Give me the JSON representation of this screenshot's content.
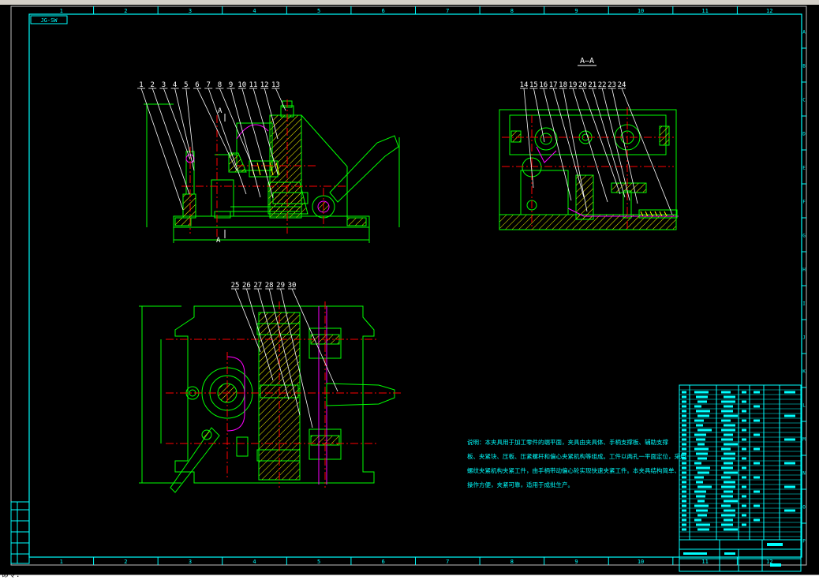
{
  "drawing": {
    "drawing_code_label": "JG-SW",
    "section_title": "A—A",
    "section_marker": "A",
    "grid_columns": [
      "1",
      "2",
      "3",
      "4",
      "5",
      "6",
      "7",
      "8",
      "9",
      "10",
      "11",
      "12"
    ],
    "grid_rows": [
      "A",
      "B",
      "C",
      "D",
      "E",
      "F",
      "G",
      "H",
      "I",
      "J",
      "K",
      "L",
      "M",
      "N",
      "O",
      "P"
    ],
    "front_view_callouts": [
      "1",
      "2",
      "3",
      "4",
      "5",
      "6",
      "7",
      "8",
      "9",
      "10",
      "11",
      "12",
      "13"
    ],
    "section_view_callouts": [
      "14",
      "15",
      "16",
      "17",
      "18",
      "19",
      "20",
      "21",
      "22",
      "23",
      "24"
    ],
    "top_view_callouts": [
      "25",
      "26",
      "27",
      "28",
      "29",
      "30"
    ],
    "tech_notes": [
      "说明：本夹具用于加工零件的端平面，夹具由夹具体、手柄支撑板、辅助支撑",
      "板、夹紧块、压板、压紧螺杆和偏心夹紧机构等组成。工件以两孔一平面定位，采用",
      "螺纹夹紧机构夹紧工件，由手柄带动偏心轮实现快速夹紧工件。本夹具结构简单、",
      "操作方便，夹紧可靠，适用于成批生产。"
    ]
  },
  "status": {
    "command_prompt": "命令:"
  },
  "colors": {
    "background": "#000000",
    "outline": "#00ff00",
    "frame": "#00ffff",
    "centerline": "#ff0000",
    "annotation": "#ffffff",
    "hidden": "#ff00ff",
    "hatch": "#ffff00"
  }
}
